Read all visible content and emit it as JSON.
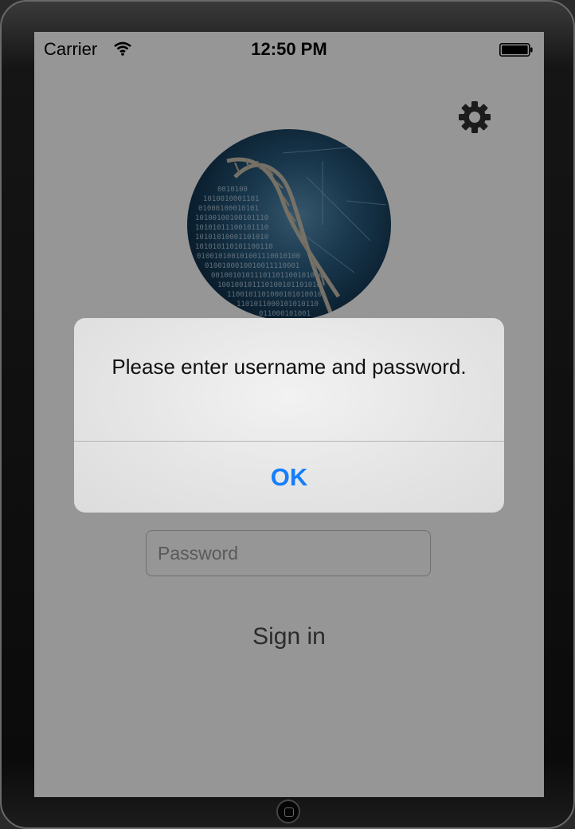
{
  "status_bar": {
    "carrier": "Carrier",
    "time": "12:50 PM",
    "wifi_icon": "wifi-icon",
    "battery_icon": "battery-icon"
  },
  "header": {
    "settings_icon": "gear-icon"
  },
  "logo": {
    "description_icon": "dna-binary-logo"
  },
  "login": {
    "password_placeholder": "Password",
    "sign_in_label": "Sign in"
  },
  "alert": {
    "message": "Please enter username and password.",
    "ok_label": "OK"
  },
  "colors": {
    "screen_background": "#ffffff",
    "dim_overlay": "rgba(0,0,0,0.41)",
    "alert_button": "#147efb",
    "device_frame": "#0b0b0b"
  }
}
